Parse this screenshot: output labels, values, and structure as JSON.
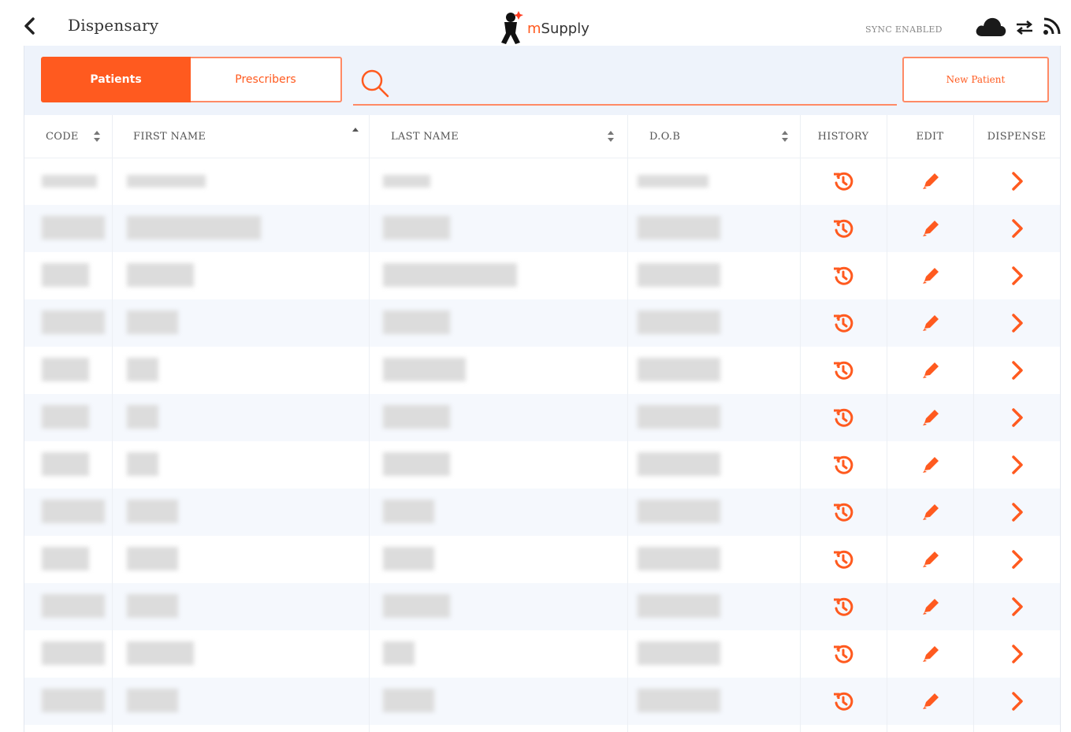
{
  "header": {
    "title": "Dispensary",
    "logo_prefix": "m",
    "logo_text": "Supply",
    "sync_status": "SYNC ENABLED"
  },
  "controls": {
    "tab_patients": "Patients",
    "tab_prescribers": "Prescribers",
    "search_placeholder": "",
    "new_patient": "New Patient"
  },
  "table": {
    "columns": [
      "CODE",
      "FIRST NAME",
      "LAST NAME",
      "D.O.B",
      "HISTORY",
      "EDIT",
      "DISPENSE"
    ],
    "sorted_column": "FIRST NAME",
    "sort_direction": "ascending",
    "row_count": 12
  },
  "colors": {
    "accent": "#ff5a1f",
    "accent_light": "#ff8a65",
    "header_bg": "#eef3fb",
    "alt_row_bg": "#f5f8fd"
  }
}
